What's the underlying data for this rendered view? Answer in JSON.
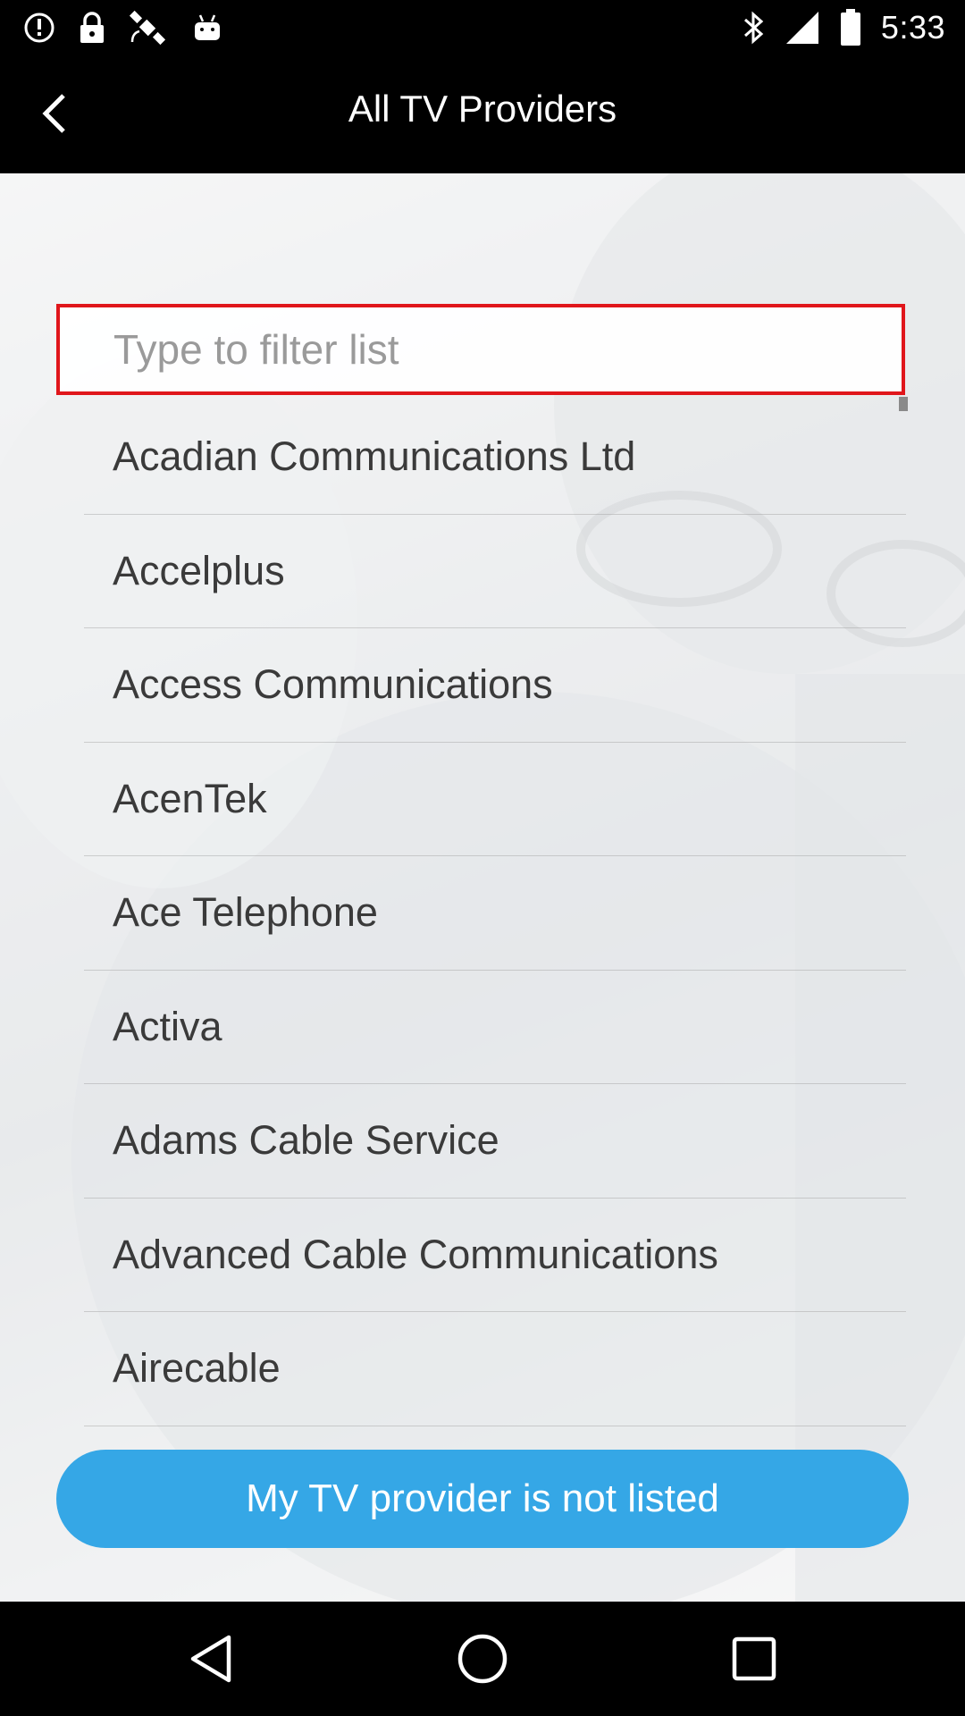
{
  "status_bar": {
    "time": "5:33",
    "left_icons": [
      "alert-circle-icon",
      "lock-icon",
      "satellite-icon",
      "android-icon"
    ],
    "right_icons": [
      "bluetooth-icon",
      "signal-icon",
      "battery-icon"
    ]
  },
  "header": {
    "title": "All TV Providers",
    "back_icon": "chevron-left-icon"
  },
  "filter": {
    "placeholder": "Type to filter list",
    "value": ""
  },
  "providers": [
    "Acadian Communications Ltd",
    "Accelplus",
    "Access Communications",
    "AcenTek",
    "Ace Telephone",
    "Activa",
    "Adams Cable Service",
    "Advanced Cable Communications",
    "Airecable"
  ],
  "footer_button": {
    "label": "My TV provider is not listed"
  },
  "nav_bar": {
    "icons": [
      "nav-back-icon",
      "nav-home-icon",
      "nav-recent-apps-icon"
    ]
  },
  "colors": {
    "accent_red": "#e0161b",
    "button_blue": "#35a7e6",
    "bar_black": "#000000"
  }
}
